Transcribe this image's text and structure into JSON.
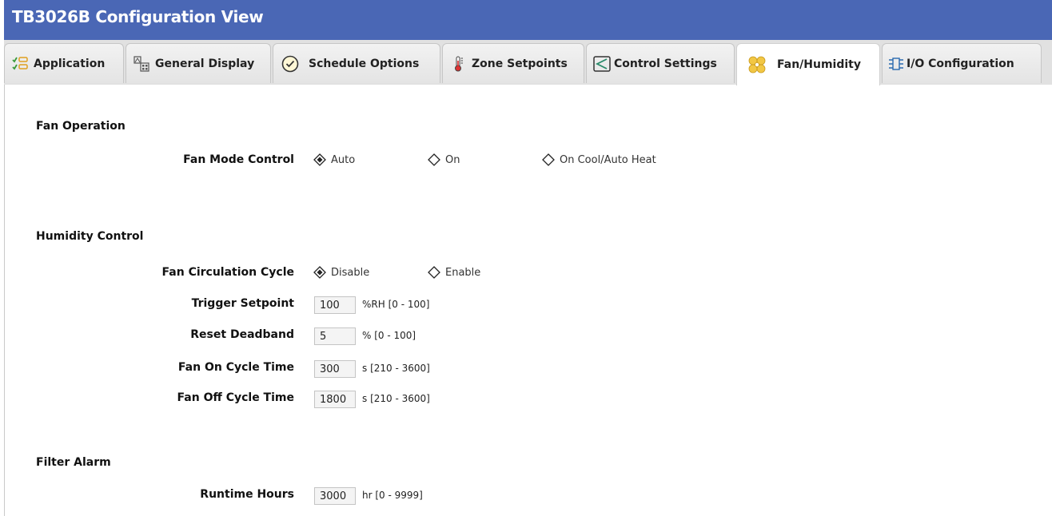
{
  "window": {
    "title": "TB3026B Configuration View"
  },
  "tabs": [
    {
      "label": "Application",
      "icon": "checklist-icon"
    },
    {
      "label": "General Display",
      "icon": "display-icon"
    },
    {
      "label": "Schedule Options",
      "icon": "clock-check-icon"
    },
    {
      "label": "Zone Setpoints",
      "icon": "thermometer-icon"
    },
    {
      "label": "Control Settings",
      "icon": "control-chart-icon"
    },
    {
      "label": "Fan/Humidity",
      "icon": "fan-icon",
      "active": true
    },
    {
      "label": "I/O Configuration",
      "icon": "io-config-icon"
    }
  ],
  "fan_operation": {
    "heading": "Fan Operation",
    "fan_mode_label": "Fan Mode Control",
    "options": [
      "Auto",
      "On",
      "On Cool/Auto Heat"
    ],
    "selected": "Auto"
  },
  "humidity_control": {
    "heading": "Humidity Control",
    "circulation_label": "Fan Circulation Cycle",
    "circulation_options": [
      "Disable",
      "Enable"
    ],
    "circulation_selected": "Disable",
    "trigger_setpoint": {
      "label": "Trigger Setpoint",
      "value": "100",
      "unit": "%RH [0 - 100]"
    },
    "reset_deadband": {
      "label": "Reset Deadband",
      "value": "5",
      "unit": "% [0 - 100]"
    },
    "fan_on_cycle": {
      "label": "Fan On Cycle Time",
      "value": "300",
      "unit": "s [210 - 3600]"
    },
    "fan_off_cycle": {
      "label": "Fan Off Cycle Time",
      "value": "1800",
      "unit": "s [210 - 3600]"
    }
  },
  "filter_alarm": {
    "heading": "Filter Alarm",
    "runtime_hours": {
      "label": "Runtime Hours",
      "value": "3000",
      "unit": "hr [0 - 9999]"
    }
  },
  "colors": {
    "title_bar": "#4a67b5",
    "tab_bg": "#e4e4e4",
    "active_tab": "#ffffff",
    "fan_icon": "#f0c040",
    "check_green": "#3a9a3a"
  }
}
